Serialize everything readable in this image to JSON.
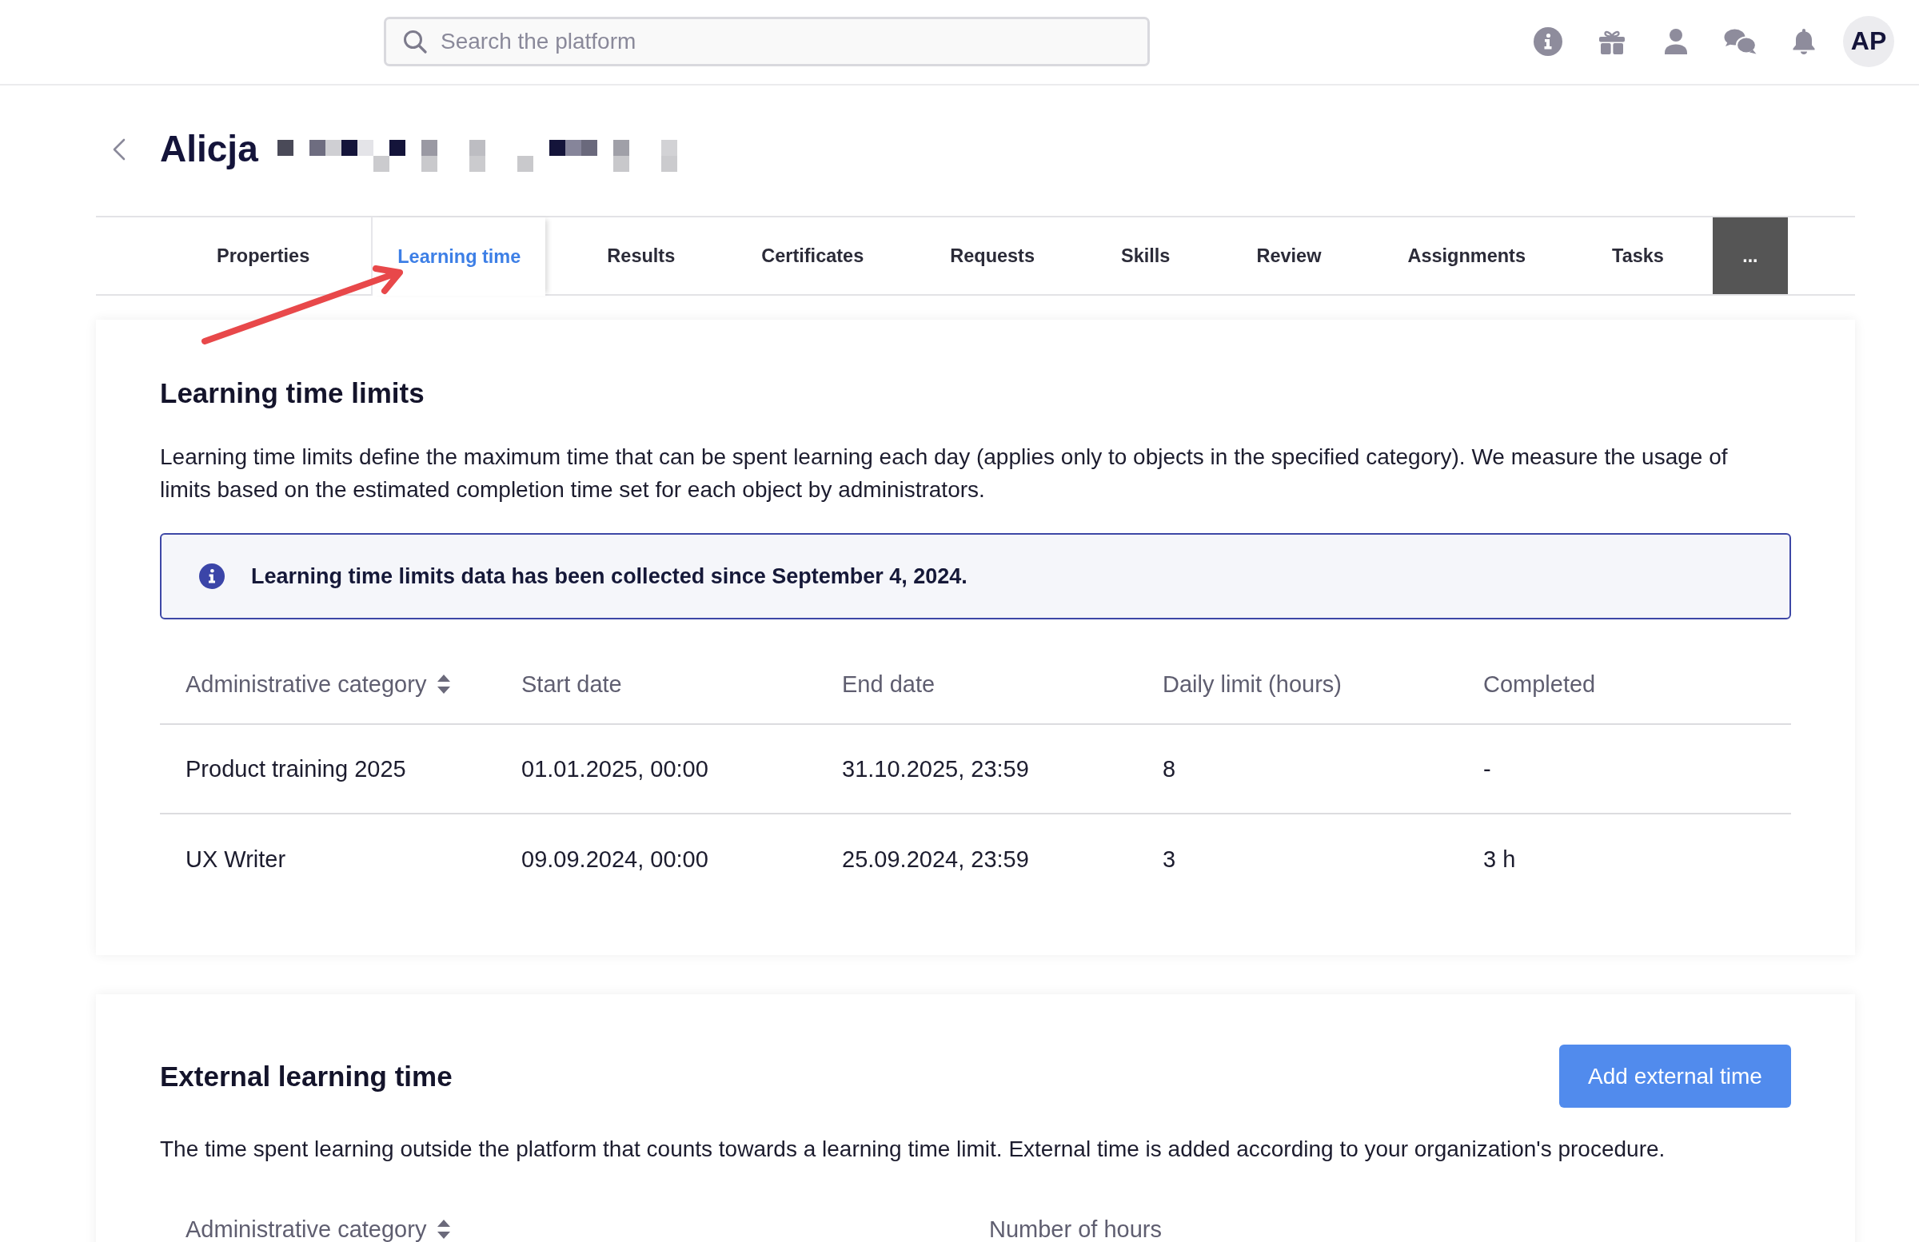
{
  "top_bar": {
    "search": {
      "placeholder": "Search the platform"
    },
    "avatar": {
      "initials": "AP"
    }
  },
  "header": {
    "title": "Alicja"
  },
  "tabs": [
    {
      "label": "Properties",
      "selected": false
    },
    {
      "label": "Learning time",
      "selected": true
    },
    {
      "label": "Results",
      "selected": false
    },
    {
      "label": "Certificates",
      "selected": false
    },
    {
      "label": "Requests",
      "selected": false
    },
    {
      "label": "Skills",
      "selected": false
    },
    {
      "label": "Review",
      "selected": false
    },
    {
      "label": "Assignments",
      "selected": false
    },
    {
      "label": "Tasks",
      "selected": false
    }
  ],
  "more_button": {
    "label": "..."
  },
  "learning_time_limits": {
    "title": "Learning time limits",
    "description": "Learning time limits define the maximum time that can be spent learning each day (applies only to objects in the specified category). We measure the usage of limits based on the estimated completion time set for each object by administrators.",
    "notice": "Learning time limits data has been collected since September 4, 2024.",
    "table": {
      "columns": [
        {
          "label": "Administrative category",
          "sortable": true
        },
        {
          "label": "Start date",
          "sortable": false
        },
        {
          "label": "End date",
          "sortable": false
        },
        {
          "label": "Daily limit (hours)",
          "sortable": false
        },
        {
          "label": "Completed",
          "sortable": false
        }
      ],
      "rows": [
        {
          "cells": [
            "Product training 2025",
            "01.01.2025, 00:00",
            "31.10.2025, 23:59",
            "8",
            "-"
          ]
        },
        {
          "cells": [
            "UX Writer",
            "09.09.2024, 00:00",
            "25.09.2024, 23:59",
            "3",
            "3 h"
          ]
        }
      ]
    }
  },
  "external_learning_time": {
    "title": "External learning time",
    "button": {
      "label": "Add external time"
    },
    "description": "The time spent learning outside the platform that counts towards a learning time limit. External time is added according to your organization's procedure.",
    "table": {
      "columns": [
        {
          "label": "Administrative category",
          "sortable": true
        },
        {
          "label": "Number of hours",
          "sortable": false
        }
      ]
    }
  }
}
